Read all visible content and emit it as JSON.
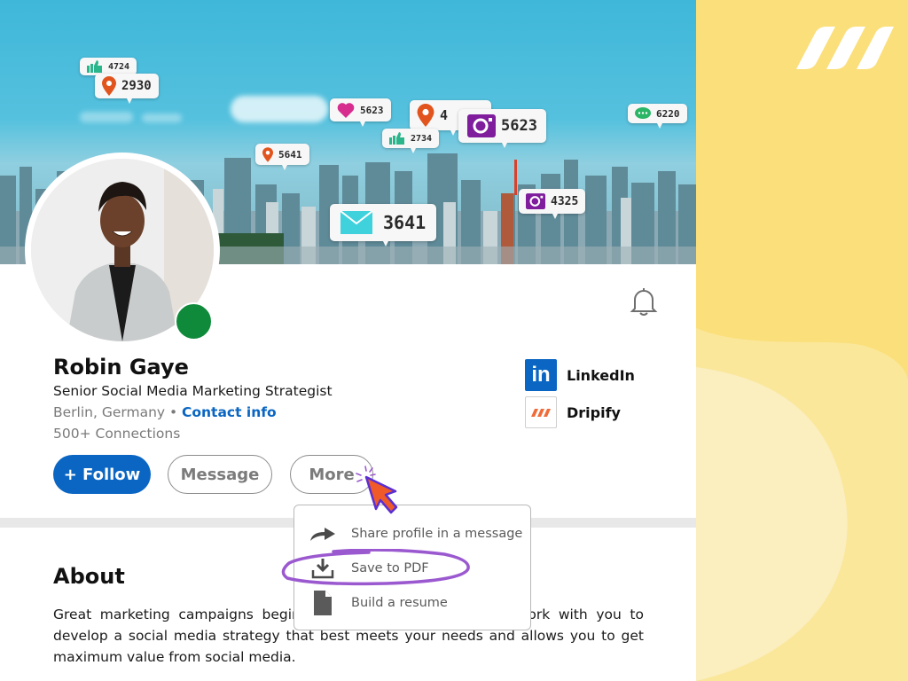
{
  "banner": {
    "bubbles": [
      {
        "icon": "thumbs-up-icon",
        "value": "4724"
      },
      {
        "icon": "location-pin-icon",
        "value": "2930"
      },
      {
        "icon": "heart-icon",
        "value": "5623"
      },
      {
        "icon": "location-pin-icon",
        "value": "4"
      },
      {
        "icon": "thumbs-up-icon",
        "value": "2734"
      },
      {
        "icon": "instagram-icon",
        "value": "5623"
      },
      {
        "icon": "chat-bubble-icon",
        "value": "6220"
      },
      {
        "icon": "location-pin-icon",
        "value": "5641"
      },
      {
        "icon": "instagram-icon",
        "value": "4325"
      },
      {
        "icon": "mail-icon",
        "value": "3641"
      }
    ]
  },
  "profile": {
    "name": "Robin Gaye",
    "headline": "Senior Social Media Marketing Strategist",
    "location": "Berlin, Germany •",
    "contact_info": "Contact info",
    "connections": "500+ Connections",
    "status": "online"
  },
  "actions": {
    "follow": "+ Follow",
    "message": "Message",
    "more": "More"
  },
  "links": [
    {
      "icon": "linkedin-icon",
      "label": "LinkedIn",
      "glyph": "in"
    },
    {
      "icon": "dripify-icon",
      "label": "Dripify"
    }
  ],
  "more_menu": {
    "items": [
      {
        "icon": "share-arrow-icon",
        "label": "Share profile in a message"
      },
      {
        "icon": "download-icon",
        "label": "Save to PDF",
        "highlighted": true
      },
      {
        "icon": "document-icon",
        "label": "Build a resume"
      }
    ]
  },
  "about": {
    "title": "About",
    "text": "Great marketing campaigns begin with a strategy. I'd love to work with you to develop a social media strategy that best meets your needs and allows you to get maximum value from social media."
  },
  "colors": {
    "linkedin_blue": "#0a66c2",
    "status_green": "#0e8a3a",
    "highlight_purple": "#9b59d0",
    "cursor_orange": "#f05a28",
    "background_yellow": "#fbdf7a"
  }
}
